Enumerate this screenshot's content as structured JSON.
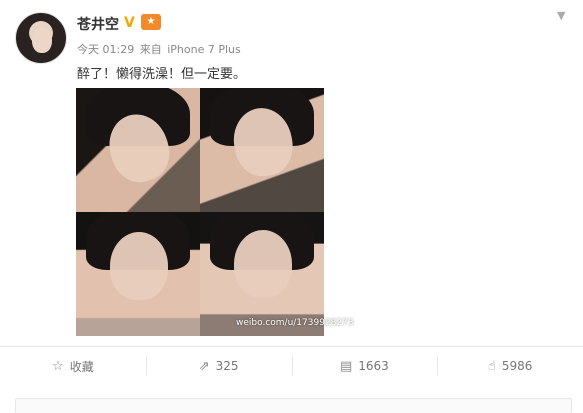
{
  "author": {
    "name": "苍井空",
    "verified_badge": "V",
    "vip_badge": "★",
    "menu_icon": "chevron-down-icon"
  },
  "post": {
    "time": "今天 01:29",
    "source_prefix": "来自",
    "source": "iPhone 7 Plus",
    "text": "醉了！懒得洗澡！但一定要。",
    "watermark": "weibo.com/u/1739928273"
  },
  "actions": {
    "favorite": {
      "icon": "star-icon",
      "label": "收藏"
    },
    "repost": {
      "icon": "repost-icon",
      "count": "325"
    },
    "comment": {
      "icon": "comment-icon",
      "count": "1663"
    },
    "like": {
      "icon": "thumbs-up-icon",
      "count": "5986"
    }
  },
  "colors": {
    "verified": "#f7a500",
    "vip": "#f28a2b",
    "text": "#333333",
    "meta": "#888888"
  }
}
